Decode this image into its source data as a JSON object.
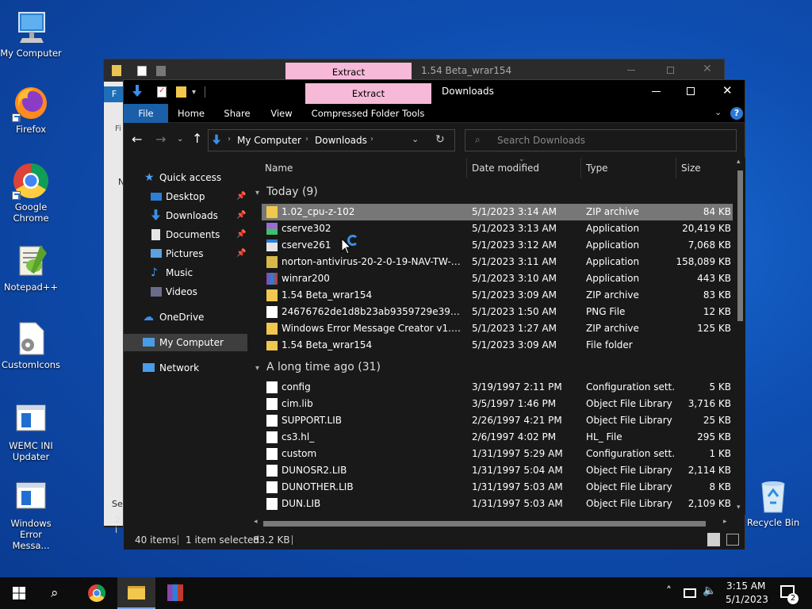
{
  "desktop": {
    "icons": [
      {
        "label": "My Computer"
      },
      {
        "label": "Firefox"
      },
      {
        "label": "Google Chrome"
      },
      {
        "label": "Notepad++"
      },
      {
        "label": "CustomIcons"
      },
      {
        "label": "WEMC INI Updater"
      },
      {
        "label": "Windows Error Messa..."
      },
      {
        "label": "Recycle Bin"
      }
    ]
  },
  "back_window": {
    "extract_tab": "Extract",
    "title": "1.54 Beta_wrar154",
    "fragments": [
      "F",
      "Fi",
      "N",
      "Sel",
      "2 i"
    ]
  },
  "window": {
    "title": "Downloads",
    "extract_tab": "Extract",
    "tabs": [
      "File",
      "Home",
      "Share",
      "View",
      "Compressed Folder Tools"
    ],
    "help": "?",
    "breadcrumb": [
      "My Computer",
      "Downloads"
    ],
    "search_placeholder": "Search Downloads",
    "nav": [
      {
        "label": "Quick access",
        "pinned": false
      },
      {
        "label": "Desktop",
        "pinned": true
      },
      {
        "label": "Downloads",
        "pinned": true
      },
      {
        "label": "Documents",
        "pinned": true
      },
      {
        "label": "Pictures",
        "pinned": true
      },
      {
        "label": "Music",
        "pinned": false
      },
      {
        "label": "Videos",
        "pinned": false
      },
      {
        "label": "OneDrive",
        "pinned": false
      },
      {
        "label": "My Computer",
        "pinned": false
      },
      {
        "label": "Network",
        "pinned": false
      }
    ],
    "columns": {
      "name": "Name",
      "date": "Date modified",
      "type": "Type",
      "size": "Size"
    },
    "groups": [
      {
        "label": "Today (9)",
        "rows": [
          {
            "name": "1.02_cpu-z-102",
            "date": "5/1/2023 3:14 AM",
            "type": "ZIP archive",
            "size": "84 KB",
            "icon": "zip-icon",
            "selected": true
          },
          {
            "name": "cserve302",
            "date": "5/1/2023 3:13 AM",
            "type": "Application",
            "size": "20,419 KB",
            "icon": "app-icon"
          },
          {
            "name": "cserve261",
            "date": "5/1/2023 3:12 AM",
            "type": "Application",
            "size": "7,068 KB",
            "icon": "app-icon"
          },
          {
            "name": "norton-antivirus-20-2-0-19-NAV-TW-30-...",
            "date": "5/1/2023 3:11 AM",
            "type": "Application",
            "size": "158,089 KB",
            "icon": "installer-icon"
          },
          {
            "name": "winrar200",
            "date": "5/1/2023 3:10 AM",
            "type": "Application",
            "size": "443 KB",
            "icon": "winrar-icon"
          },
          {
            "name": "1.54 Beta_wrar154",
            "date": "5/1/2023 3:09 AM",
            "type": "ZIP archive",
            "size": "83 KB",
            "icon": "zip-icon"
          },
          {
            "name": "24676762de1d8b23ab9359729e39a55a",
            "date": "5/1/2023 1:50 AM",
            "type": "PNG File",
            "size": "12 KB",
            "icon": "image-icon"
          },
          {
            "name": "Windows Error Message Creator v1.40.32 ...",
            "date": "5/1/2023 1:27 AM",
            "type": "ZIP archive",
            "size": "125 KB",
            "icon": "zip-icon"
          },
          {
            "name": "1.54 Beta_wrar154",
            "date": "5/1/2023 3:09 AM",
            "type": "File folder",
            "size": "",
            "icon": "folder-icon"
          }
        ]
      },
      {
        "label": "A long time ago (31)",
        "rows": [
          {
            "name": "config",
            "date": "3/19/1997 2:11 PM",
            "type": "Configuration sett...",
            "size": "5 KB",
            "icon": "config-file-icon"
          },
          {
            "name": "cim.lib",
            "date": "3/5/1997 1:46 PM",
            "type": "Object File Library",
            "size": "3,716 KB",
            "icon": "file-icon"
          },
          {
            "name": "SUPPORT.LIB",
            "date": "2/26/1997 4:21 PM",
            "type": "Object File Library",
            "size": "25 KB",
            "icon": "file-icon"
          },
          {
            "name": "cs3.hl_",
            "date": "2/6/1997 4:02 PM",
            "type": "HL_ File",
            "size": "295 KB",
            "icon": "file-icon"
          },
          {
            "name": "custom",
            "date": "1/31/1997 5:29 AM",
            "type": "Configuration sett...",
            "size": "1 KB",
            "icon": "config-file-icon"
          },
          {
            "name": "DUNOSR2.LIB",
            "date": "1/31/1997 5:04 AM",
            "type": "Object File Library",
            "size": "2,114 KB",
            "icon": "file-icon"
          },
          {
            "name": "DUNOTHER.LIB",
            "date": "1/31/1997 5:03 AM",
            "type": "Object File Library",
            "size": "8 KB",
            "icon": "file-icon"
          },
          {
            "name": "DUN.LIB",
            "date": "1/31/1997 5:03 AM",
            "type": "Object File Library",
            "size": "2,109 KB",
            "icon": "file-icon"
          }
        ]
      }
    ],
    "status": {
      "items": "40 items",
      "selected": "1 item selected",
      "size": "83.2 KB"
    }
  },
  "taskbar": {
    "time": "3:15 AM",
    "date": "5/1/2023",
    "notifications": "2"
  },
  "colors": {
    "selected_row": "#777777",
    "taskbar": "#0d0d0d",
    "extract_tab": "#f7b9d8",
    "desktop": "#0f4fb3"
  }
}
